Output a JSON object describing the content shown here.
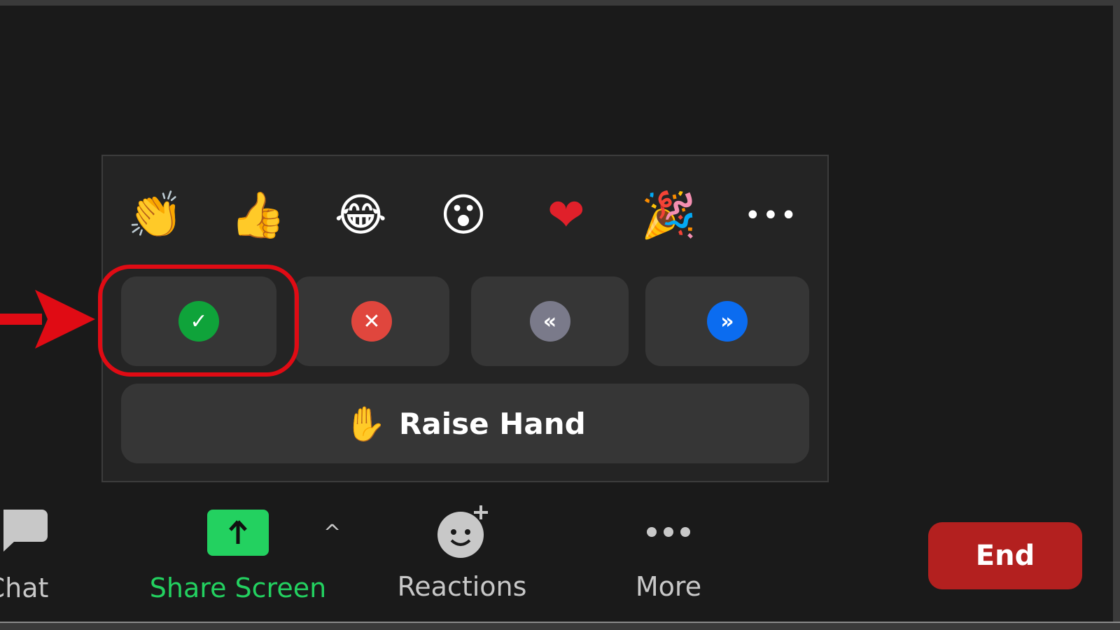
{
  "reactions_panel": {
    "emojis": [
      {
        "name": "clapping-hands",
        "glyph": "👏"
      },
      {
        "name": "thumbs-up",
        "glyph": "👍"
      },
      {
        "name": "tears-of-joy",
        "glyph": "😂"
      },
      {
        "name": "open-mouth",
        "glyph": "😮"
      },
      {
        "name": "heart",
        "glyph": "❤"
      },
      {
        "name": "party-popper",
        "glyph": "🎉"
      }
    ],
    "more_glyph": "•••",
    "feedback_buttons": [
      {
        "name": "yes",
        "glyph": "✓",
        "color": "#0fa33a"
      },
      {
        "name": "no",
        "glyph": "✕",
        "color": "#e0463d"
      },
      {
        "name": "slow-down",
        "glyph": "«",
        "color": "#7a7a8a"
      },
      {
        "name": "speed-up",
        "glyph": "»",
        "color": "#0b6cf0"
      }
    ],
    "raise_hand_glyph": "✋",
    "raise_hand_label": "Raise Hand"
  },
  "toolbar": {
    "chat_label": "Chat",
    "share_screen_label": "Share Screen",
    "share_screen_caret": "^",
    "reactions_label": "Reactions",
    "more_label": "More",
    "end_label": "End"
  },
  "colors": {
    "accent_green": "#23d160",
    "end_red": "#b3201f",
    "highlight_red": "#e00b14"
  }
}
